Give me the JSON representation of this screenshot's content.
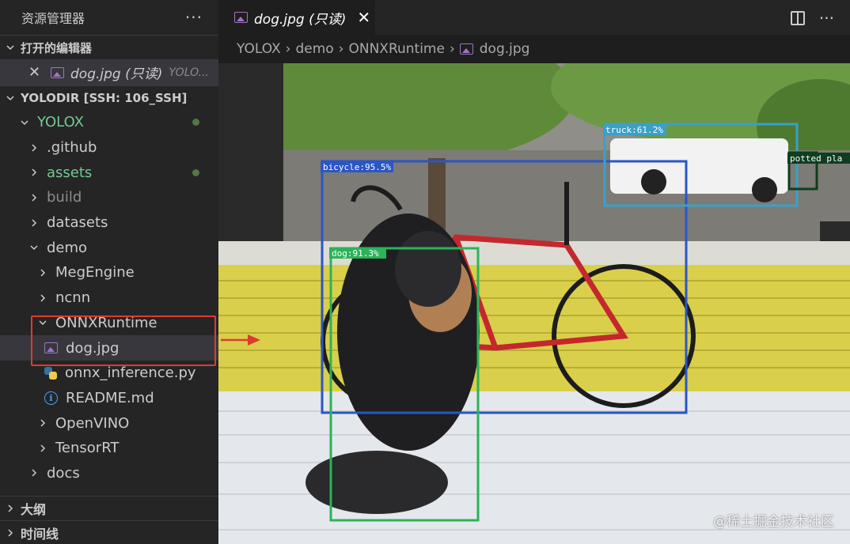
{
  "sidebar": {
    "title": "资源管理器",
    "more": "···",
    "open_editors": {
      "label": "打开的编辑器",
      "file": "dog.jpg (只读)",
      "path": "YOLO..."
    },
    "workspace": "YOLODIR [SSH: 106_SSH]",
    "tree": {
      "root": "YOLOX",
      "github": ".github",
      "assets": "assets",
      "build": "build",
      "datasets": "datasets",
      "demo": "demo",
      "megengine": "MegEngine",
      "ncnn": "ncnn",
      "onnxruntime": "ONNXRuntime",
      "dog": "dog.jpg",
      "onnx_inference": "onnx_inference.py",
      "readme": "README.md",
      "openvino": "OpenVINO",
      "tensorrt": "TensorRT",
      "docs": "docs"
    },
    "outline": "大纲",
    "timeline": "时间线"
  },
  "tab": {
    "title": "dog.jpg (只读)",
    "close": "✕"
  },
  "breadcrumb": [
    "YOLOX",
    "demo",
    "ONNXRuntime",
    "dog.jpg"
  ],
  "detections": [
    {
      "label": "bicycle:95.5%",
      "color": "#2a56c6"
    },
    {
      "label": "dog:91.3%",
      "color": "#2bb35a"
    },
    {
      "label": "truck:61.2%",
      "color": "#3aa0c8"
    },
    {
      "label": "potted pla",
      "color": "#0f3d1f"
    }
  ],
  "watermark": "@稀土掘金技术社区",
  "colors": {
    "accent_red": "#e03a2f",
    "git_green": "#73c991"
  }
}
